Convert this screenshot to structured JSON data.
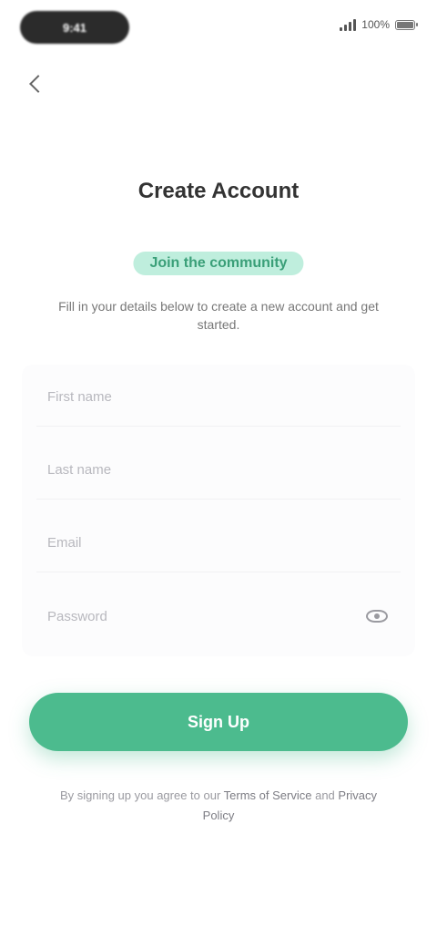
{
  "status_bar": {
    "time": "9:41",
    "battery": "100%",
    "battery_level": 1.0
  },
  "header": {
    "back_icon": "chevron-left-icon",
    "title": "Create Account",
    "highlight": "Join the community",
    "subtitle": "Fill in your details below to create a new account and get started."
  },
  "form": {
    "fields": [
      {
        "name": "first-name-field",
        "placeholder": "First name",
        "value": ""
      },
      {
        "name": "last-name-field",
        "placeholder": "Last name",
        "value": ""
      },
      {
        "name": "email-field",
        "placeholder": "Email",
        "value": ""
      },
      {
        "name": "password-field",
        "placeholder": "Password",
        "value": "",
        "icon": "eye-icon"
      }
    ]
  },
  "primary_button": {
    "label": "Sign Up"
  },
  "footer": {
    "terms_prefix": "By signing up you agree to our ",
    "terms_link": "Terms of Service",
    "terms_middle": " and ",
    "privacy_link": "Privacy Policy"
  },
  "colors": {
    "accent": "#4cbb8e",
    "accent_light": "#bfeedd",
    "background": "#ffffff"
  }
}
